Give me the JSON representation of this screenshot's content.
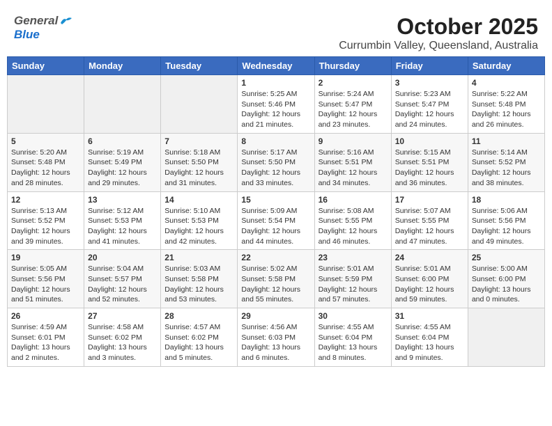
{
  "header": {
    "logo_general": "General",
    "logo_blue": "Blue",
    "title": "October 2025",
    "subtitle": "Currumbin Valley, Queensland, Australia"
  },
  "days_of_week": [
    "Sunday",
    "Monday",
    "Tuesday",
    "Wednesday",
    "Thursday",
    "Friday",
    "Saturday"
  ],
  "weeks": [
    [
      {
        "day": "",
        "info": ""
      },
      {
        "day": "",
        "info": ""
      },
      {
        "day": "",
        "info": ""
      },
      {
        "day": "1",
        "info": "Sunrise: 5:25 AM\nSunset: 5:46 PM\nDaylight: 12 hours\nand 21 minutes."
      },
      {
        "day": "2",
        "info": "Sunrise: 5:24 AM\nSunset: 5:47 PM\nDaylight: 12 hours\nand 23 minutes."
      },
      {
        "day": "3",
        "info": "Sunrise: 5:23 AM\nSunset: 5:47 PM\nDaylight: 12 hours\nand 24 minutes."
      },
      {
        "day": "4",
        "info": "Sunrise: 5:22 AM\nSunset: 5:48 PM\nDaylight: 12 hours\nand 26 minutes."
      }
    ],
    [
      {
        "day": "5",
        "info": "Sunrise: 5:20 AM\nSunset: 5:48 PM\nDaylight: 12 hours\nand 28 minutes."
      },
      {
        "day": "6",
        "info": "Sunrise: 5:19 AM\nSunset: 5:49 PM\nDaylight: 12 hours\nand 29 minutes."
      },
      {
        "day": "7",
        "info": "Sunrise: 5:18 AM\nSunset: 5:50 PM\nDaylight: 12 hours\nand 31 minutes."
      },
      {
        "day": "8",
        "info": "Sunrise: 5:17 AM\nSunset: 5:50 PM\nDaylight: 12 hours\nand 33 minutes."
      },
      {
        "day": "9",
        "info": "Sunrise: 5:16 AM\nSunset: 5:51 PM\nDaylight: 12 hours\nand 34 minutes."
      },
      {
        "day": "10",
        "info": "Sunrise: 5:15 AM\nSunset: 5:51 PM\nDaylight: 12 hours\nand 36 minutes."
      },
      {
        "day": "11",
        "info": "Sunrise: 5:14 AM\nSunset: 5:52 PM\nDaylight: 12 hours\nand 38 minutes."
      }
    ],
    [
      {
        "day": "12",
        "info": "Sunrise: 5:13 AM\nSunset: 5:52 PM\nDaylight: 12 hours\nand 39 minutes."
      },
      {
        "day": "13",
        "info": "Sunrise: 5:12 AM\nSunset: 5:53 PM\nDaylight: 12 hours\nand 41 minutes."
      },
      {
        "day": "14",
        "info": "Sunrise: 5:10 AM\nSunset: 5:53 PM\nDaylight: 12 hours\nand 42 minutes."
      },
      {
        "day": "15",
        "info": "Sunrise: 5:09 AM\nSunset: 5:54 PM\nDaylight: 12 hours\nand 44 minutes."
      },
      {
        "day": "16",
        "info": "Sunrise: 5:08 AM\nSunset: 5:55 PM\nDaylight: 12 hours\nand 46 minutes."
      },
      {
        "day": "17",
        "info": "Sunrise: 5:07 AM\nSunset: 5:55 PM\nDaylight: 12 hours\nand 47 minutes."
      },
      {
        "day": "18",
        "info": "Sunrise: 5:06 AM\nSunset: 5:56 PM\nDaylight: 12 hours\nand 49 minutes."
      }
    ],
    [
      {
        "day": "19",
        "info": "Sunrise: 5:05 AM\nSunset: 5:56 PM\nDaylight: 12 hours\nand 51 minutes."
      },
      {
        "day": "20",
        "info": "Sunrise: 5:04 AM\nSunset: 5:57 PM\nDaylight: 12 hours\nand 52 minutes."
      },
      {
        "day": "21",
        "info": "Sunrise: 5:03 AM\nSunset: 5:58 PM\nDaylight: 12 hours\nand 53 minutes."
      },
      {
        "day": "22",
        "info": "Sunrise: 5:02 AM\nSunset: 5:58 PM\nDaylight: 12 hours\nand 55 minutes."
      },
      {
        "day": "23",
        "info": "Sunrise: 5:01 AM\nSunset: 5:59 PM\nDaylight: 12 hours\nand 57 minutes."
      },
      {
        "day": "24",
        "info": "Sunrise: 5:01 AM\nSunset: 6:00 PM\nDaylight: 12 hours\nand 59 minutes."
      },
      {
        "day": "25",
        "info": "Sunrise: 5:00 AM\nSunset: 6:00 PM\nDaylight: 13 hours\nand 0 minutes."
      }
    ],
    [
      {
        "day": "26",
        "info": "Sunrise: 4:59 AM\nSunset: 6:01 PM\nDaylight: 13 hours\nand 2 minutes."
      },
      {
        "day": "27",
        "info": "Sunrise: 4:58 AM\nSunset: 6:02 PM\nDaylight: 13 hours\nand 3 minutes."
      },
      {
        "day": "28",
        "info": "Sunrise: 4:57 AM\nSunset: 6:02 PM\nDaylight: 13 hours\nand 5 minutes."
      },
      {
        "day": "29",
        "info": "Sunrise: 4:56 AM\nSunset: 6:03 PM\nDaylight: 13 hours\nand 6 minutes."
      },
      {
        "day": "30",
        "info": "Sunrise: 4:55 AM\nSunset: 6:04 PM\nDaylight: 13 hours\nand 8 minutes."
      },
      {
        "day": "31",
        "info": "Sunrise: 4:55 AM\nSunset: 6:04 PM\nDaylight: 13 hours\nand 9 minutes."
      },
      {
        "day": "",
        "info": ""
      }
    ]
  ]
}
